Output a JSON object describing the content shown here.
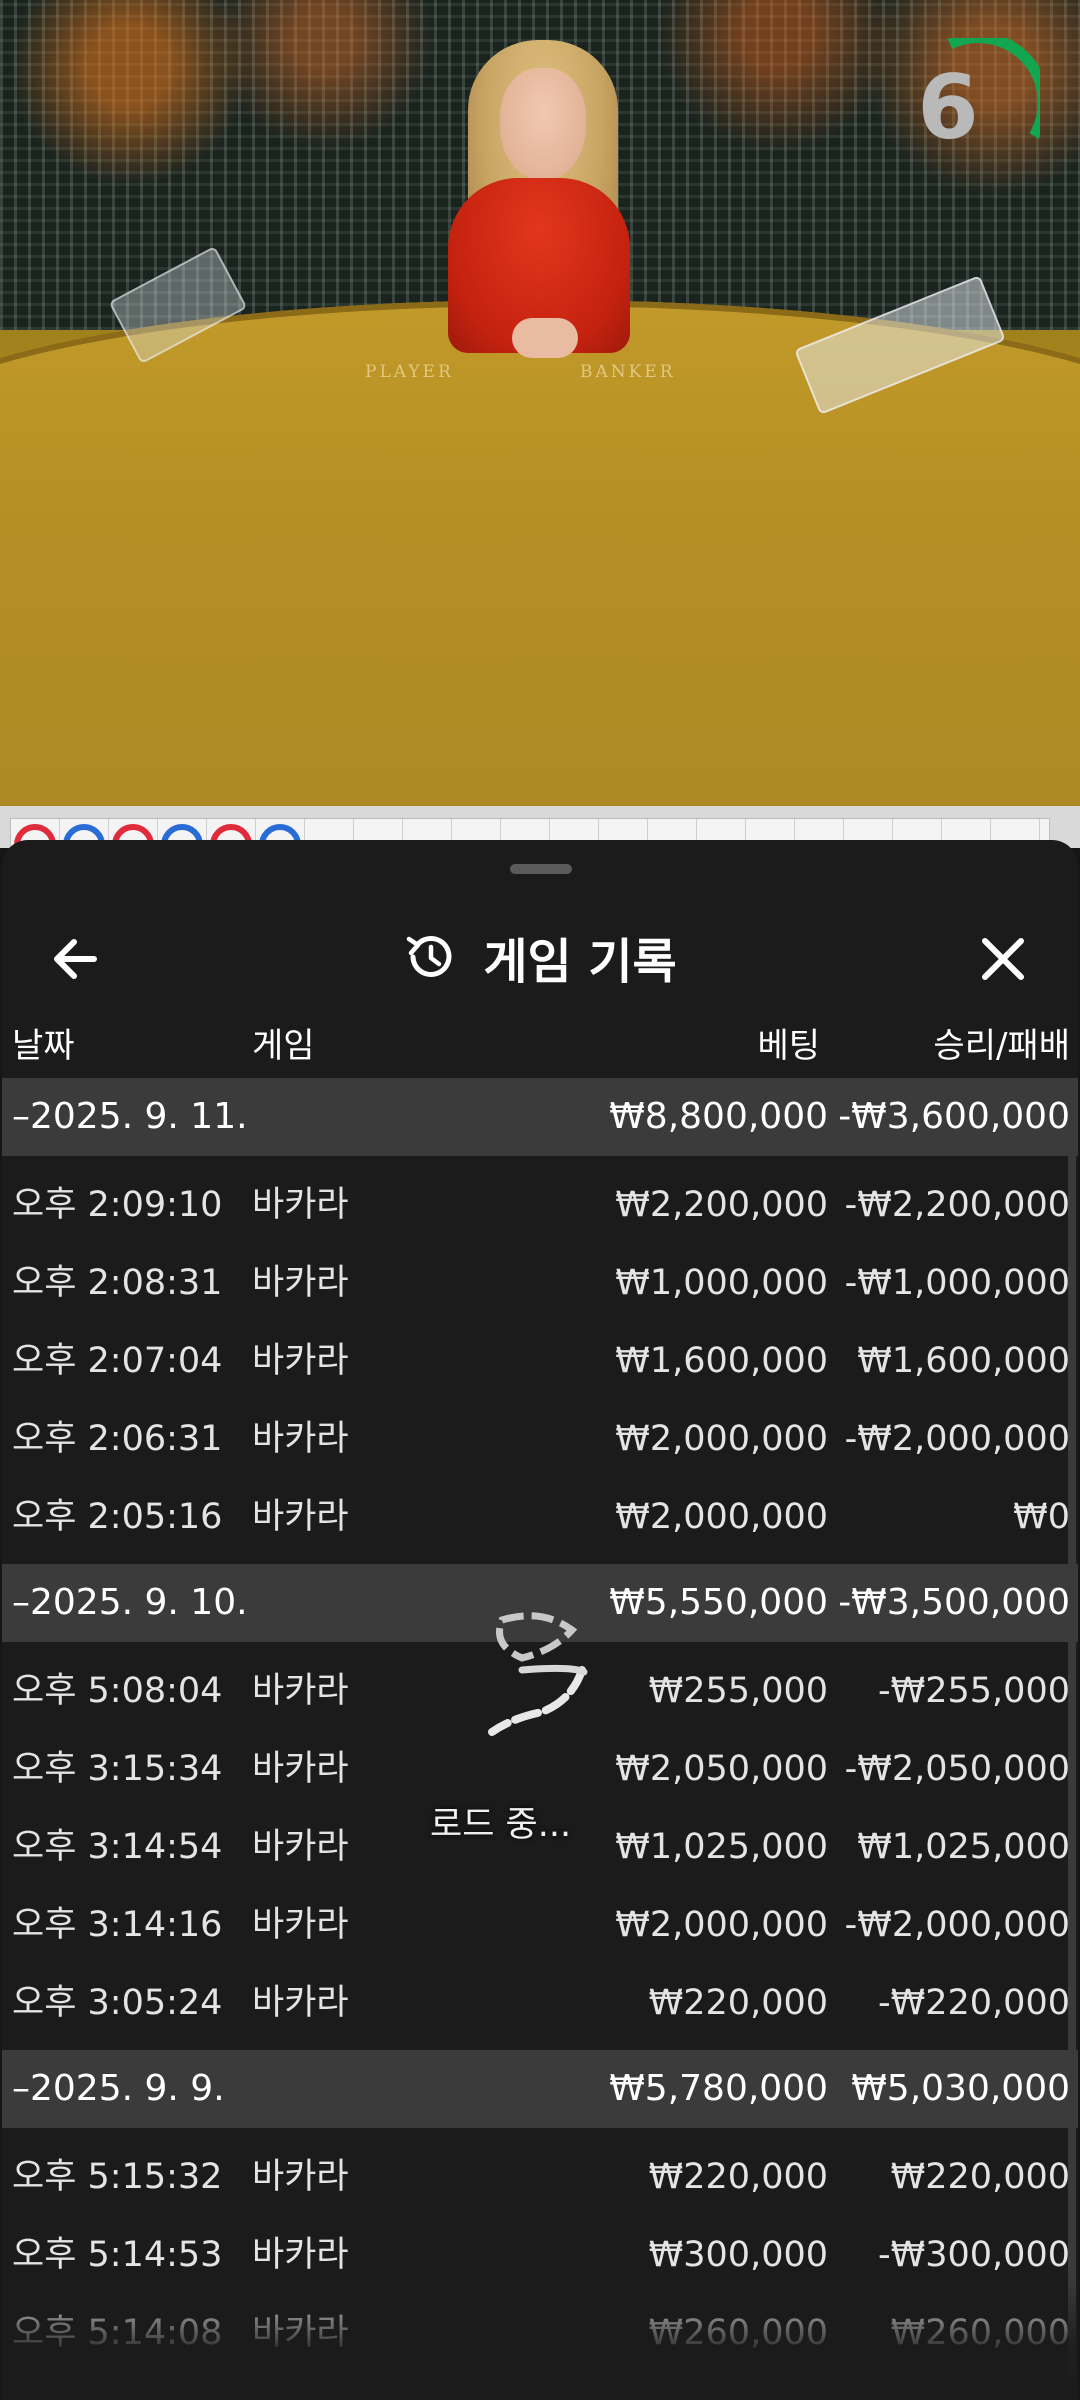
{
  "video": {
    "countdown": "6",
    "countdown_color": "#12a650",
    "table_labels": {
      "player": "PLAYER",
      "banker": "BANKER"
    }
  },
  "roadmap": {
    "beads": [
      "banker",
      "player",
      "banker",
      "player",
      "banker",
      "player"
    ],
    "colors": {
      "banker": "#e02b3a",
      "player": "#2a6cd6"
    }
  },
  "sheet": {
    "title": "게임 기록",
    "icons": {
      "back": "arrow-left-icon",
      "history": "history-icon",
      "close": "close-icon"
    },
    "columns": {
      "date": "날짜",
      "game": "게임",
      "bet": "베팅",
      "result": "승리/패배"
    },
    "groups": [
      {
        "date": "2025. 9. 11.",
        "bet": "₩8,800,000",
        "result": "-₩3,600,000",
        "rows": [
          {
            "time": "오후 2:09:10",
            "game": "바카라",
            "bet": "₩2,200,000",
            "result": "-₩2,200,000"
          },
          {
            "time": "오후 2:08:31",
            "game": "바카라",
            "bet": "₩1,000,000",
            "result": "-₩1,000,000"
          },
          {
            "time": "오후 2:07:04",
            "game": "바카라",
            "bet": "₩1,600,000",
            "result": "₩1,600,000"
          },
          {
            "time": "오후 2:06:31",
            "game": "바카라",
            "bet": "₩2,000,000",
            "result": "-₩2,000,000"
          },
          {
            "time": "오후 2:05:16",
            "game": "바카라",
            "bet": "₩2,000,000",
            "result": "₩0"
          }
        ]
      },
      {
        "date": "2025. 9. 10.",
        "bet": "₩5,550,000",
        "result": "-₩3,500,000",
        "rows": [
          {
            "time": "오후 5:08:04",
            "game": "바카라",
            "bet": "₩255,000",
            "result": "-₩255,000"
          },
          {
            "time": "오후 3:15:34",
            "game": "바카라",
            "bet": "₩2,050,000",
            "result": "-₩2,050,000"
          },
          {
            "time": "오후 3:14:54",
            "game": "바카라",
            "bet": "₩1,025,000",
            "result": "₩1,025,000"
          },
          {
            "time": "오후 3:14:16",
            "game": "바카라",
            "bet": "₩2,000,000",
            "result": "-₩2,000,000"
          },
          {
            "time": "오후 3:05:24",
            "game": "바카라",
            "bet": "₩220,000",
            "result": "-₩220,000"
          }
        ]
      },
      {
        "date": "2025. 9. 9.",
        "bet": "₩5,780,000",
        "result": "₩5,030,000",
        "rows": [
          {
            "time": "오후 5:15:32",
            "game": "바카라",
            "bet": "₩220,000",
            "result": "₩220,000"
          },
          {
            "time": "오후 5:14:53",
            "game": "바카라",
            "bet": "₩300,000",
            "result": "-₩300,000"
          },
          {
            "time": "오후 5:14:08",
            "game": "바카라",
            "bet": "₩260,000",
            "result": "₩260,000"
          }
        ]
      }
    ],
    "loading_text": "로드 중..."
  }
}
